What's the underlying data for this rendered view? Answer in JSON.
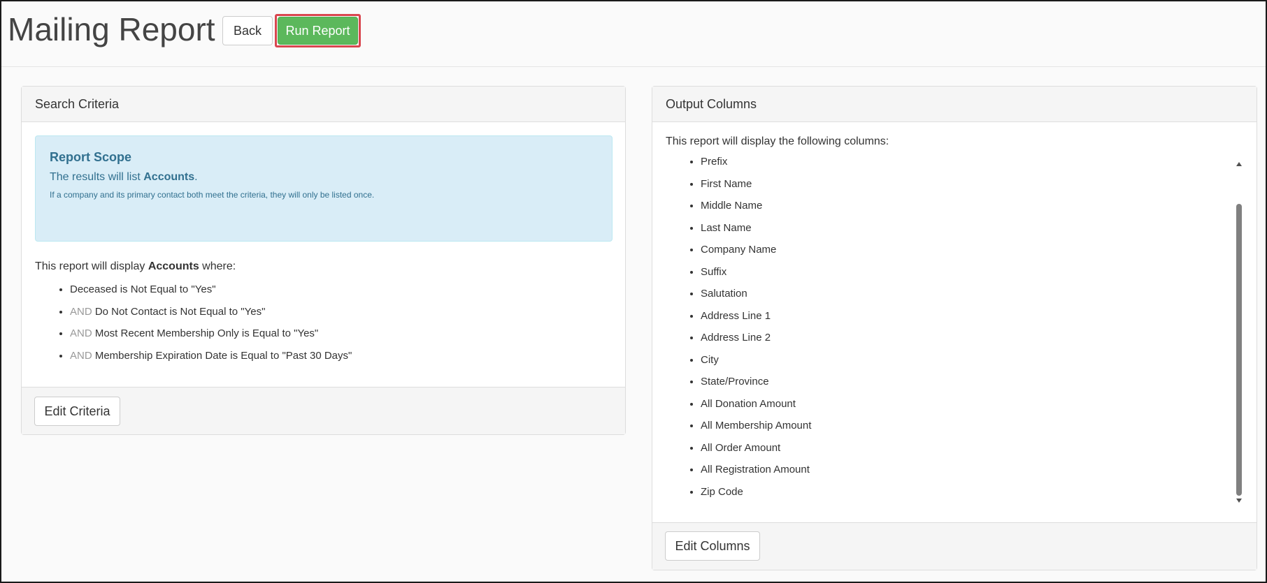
{
  "page": {
    "title": "Mailing Report",
    "back_label": "Back",
    "run_label": "Run Report"
  },
  "search_criteria": {
    "heading": "Search Criteria",
    "scope": {
      "title": "Report Scope",
      "line_prefix": "The results will list ",
      "line_entity": "Accounts",
      "line_suffix": ".",
      "note": "If a company and its primary contact both meet the criteria, they will only be listed once."
    },
    "intro_prefix": "This report will display ",
    "intro_entity": "Accounts",
    "intro_suffix": " where:",
    "conditions": [
      {
        "conjunction": "",
        "text": "Deceased is Not Equal to \"Yes\""
      },
      {
        "conjunction": "AND",
        "text": " Do Not Contact is Not Equal to \"Yes\""
      },
      {
        "conjunction": "AND",
        "text": " Most Recent Membership Only is Equal to \"Yes\""
      },
      {
        "conjunction": "AND",
        "text": " Membership Expiration Date is Equal to \"Past 30 Days\""
      }
    ],
    "edit_label": "Edit Criteria"
  },
  "output_columns": {
    "heading": "Output Columns",
    "intro": "This report will display the following columns:",
    "columns": [
      "Prefix",
      "First Name",
      "Middle Name",
      "Last Name",
      "Company Name",
      "Suffix",
      "Salutation",
      "Address Line 1",
      "Address Line 2",
      "City",
      "State/Province",
      "All Donation Amount",
      "All Membership Amount",
      "All Order Amount",
      "All Registration Amount",
      "Zip Code"
    ],
    "edit_label": "Edit Columns"
  },
  "colors": {
    "run_button": "#5cb85c",
    "run_highlight": "#d9464f",
    "scope_background": "#d9edf7",
    "scope_text": "#31708f"
  }
}
